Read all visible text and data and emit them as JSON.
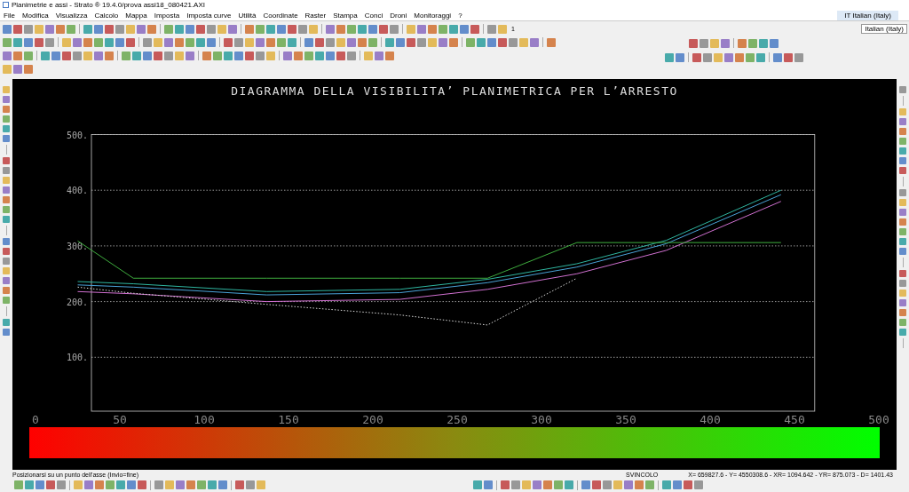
{
  "window": {
    "title": "Planimetrie e assi - Strato ® 19.4.0/prova assi18_080421.AXI"
  },
  "language": {
    "indicator": "IT Italian (Italy)",
    "tooltip": "Italian (Italy)"
  },
  "menu": [
    "File",
    "Modifica",
    "Visualizza",
    "Calcolo",
    "Mappa",
    "Imposta",
    "Imposta curve",
    "Utilità",
    "Coordinate",
    "Raster",
    "Stampa",
    "Conci",
    "Droni",
    "Monitoraggi",
    "?"
  ],
  "toolbar": {
    "counter": "1"
  },
  "canvas": {
    "chart_data": {
      "type": "line",
      "grid": true,
      "title": "DIAGRAMMA DELLA VISIBILITA’  PLANIMETRICA PER L’ARRESTO",
      "x": [
        25,
        58,
        137,
        216,
        268,
        321,
        374,
        442
      ],
      "xlim": [
        0,
        500
      ],
      "ylim": [
        0,
        500
      ],
      "xticks": [
        0,
        50,
        100,
        150,
        200,
        250,
        300,
        350,
        400,
        450,
        500
      ],
      "yticks": [
        {
          "value": 100,
          "label": "100."
        },
        {
          "value": 200,
          "label": "200."
        },
        {
          "value": 300,
          "label": "300."
        },
        {
          "value": 400,
          "label": "400."
        },
        {
          "value": 500,
          "label": "500."
        }
      ],
      "series": [
        {
          "color": "#2fb5a0",
          "values": [
            236,
            232,
            218,
            222,
            240,
            268,
            310,
            400
          ]
        },
        {
          "color": "#4aa3d8",
          "values": [
            230,
            226,
            212,
            216,
            234,
            262,
            304,
            392
          ]
        },
        {
          "color": "#d070d0",
          "values": [
            218,
            214,
            200,
            204,
            222,
            250,
            292,
            380
          ]
        },
        {
          "color": "#3fae3f",
          "values": [
            309,
            242,
            242,
            242,
            242,
            306,
            306,
            306
          ]
        },
        {
          "color": "#d8d8d8",
          "line_style": "dotted",
          "values": [
            226,
            215,
            195,
            176,
            158,
            242,
            null,
            null
          ]
        }
      ]
    }
  },
  "status": {
    "prompt": "Posizionarsi su un punto dell'asse (Invio=fine)",
    "mode": "SVINCOLO",
    "coordinates": "X= 659827.6 - Y= 4550308.6 - XR= 1094.642 - YR= 875.073 - D= 1401.43"
  }
}
